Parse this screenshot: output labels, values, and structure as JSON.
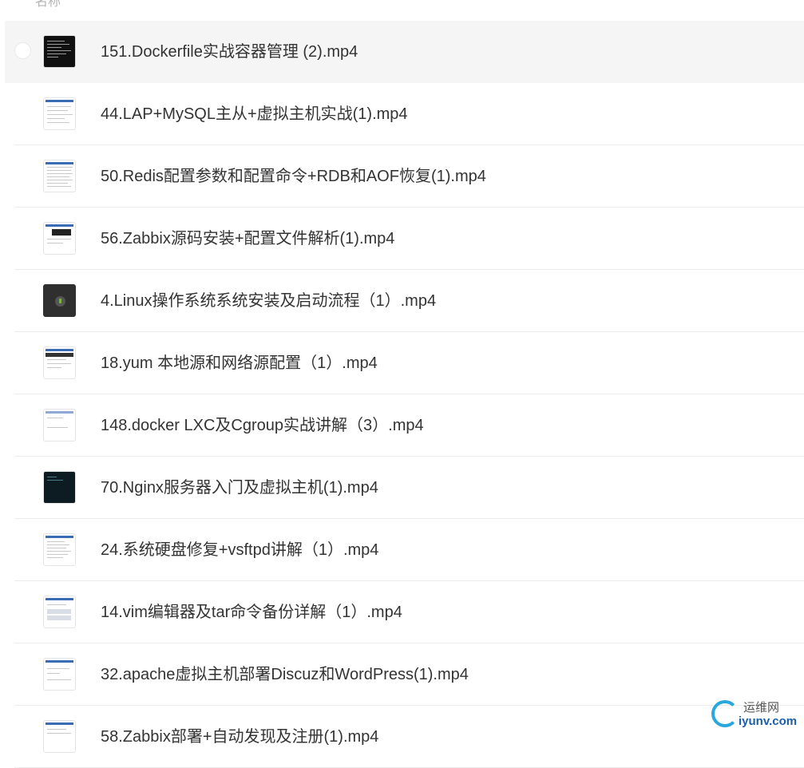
{
  "list": {
    "column_header": "名称",
    "files": [
      {
        "name": "151.Dockerfile实战容器管理 (2).mp4",
        "thumbnail": "terminal-screenshot",
        "selected": true
      },
      {
        "name": "44.LAP+MySQL主从+虚拟主机实战(1).mp4",
        "thumbnail": "document-screenshot",
        "selected": false
      },
      {
        "name": "50.Redis配置参数和配置命令+RDB和AOF恢复(1).mp4",
        "thumbnail": "document-screenshot",
        "selected": false
      },
      {
        "name": "56.Zabbix源码安装+配置文件解析(1).mp4",
        "thumbnail": "document-screenshot",
        "selected": false
      },
      {
        "name": "4.Linux操作系统系统安装及启动流程（1）.mp4",
        "thumbnail": "audio-icon",
        "selected": false
      },
      {
        "name": "18.yum 本地源和网络源配置（1）.mp4",
        "thumbnail": "document-screenshot",
        "selected": false
      },
      {
        "name": "148.docker LXC及Cgroup实战讲解（3）.mp4",
        "thumbnail": "document-screenshot",
        "selected": false
      },
      {
        "name": "70.Nginx服务器入门及虚拟主机(1).mp4",
        "thumbnail": "shell-screenshot",
        "selected": false
      },
      {
        "name": "24.系统硬盘修复+vsftpd讲解（1）.mp4",
        "thumbnail": "document-screenshot",
        "selected": false
      },
      {
        "name": "14.vim编辑器及tar命令备份详解（1）.mp4",
        "thumbnail": "document-screenshot",
        "selected": false
      },
      {
        "name": "32.apache虚拟主机部署Discuz和WordPress(1).mp4",
        "thumbnail": "document-screenshot",
        "selected": false
      },
      {
        "name": "58.Zabbix部署+自动发现及注册(1).mp4",
        "thumbnail": "document-screenshot",
        "selected": false
      }
    ]
  },
  "watermark": {
    "top_text": "运维网",
    "bottom_text": "iyunv.com"
  }
}
